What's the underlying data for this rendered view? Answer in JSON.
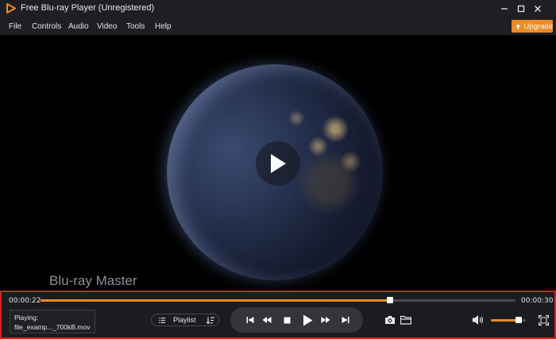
{
  "window": {
    "title": "Free Blu-ray Player (Unregistered)",
    "accent_color": "#f08a24"
  },
  "menu": {
    "items": [
      "File",
      "Controls",
      "Audio",
      "Video",
      "Tools",
      "Help"
    ],
    "upgrade_label": "Upgrade"
  },
  "video": {
    "watermark": "Blu-ray Master",
    "center_icon": "play-icon"
  },
  "player": {
    "current_time": "00:00:22",
    "total_time": "00:00:30",
    "progress": 0.735,
    "volume": 0.8,
    "playing_label": "Playing:",
    "playing_file": "file_examp..._700kB.mov",
    "playlist_label": "Playlist"
  }
}
